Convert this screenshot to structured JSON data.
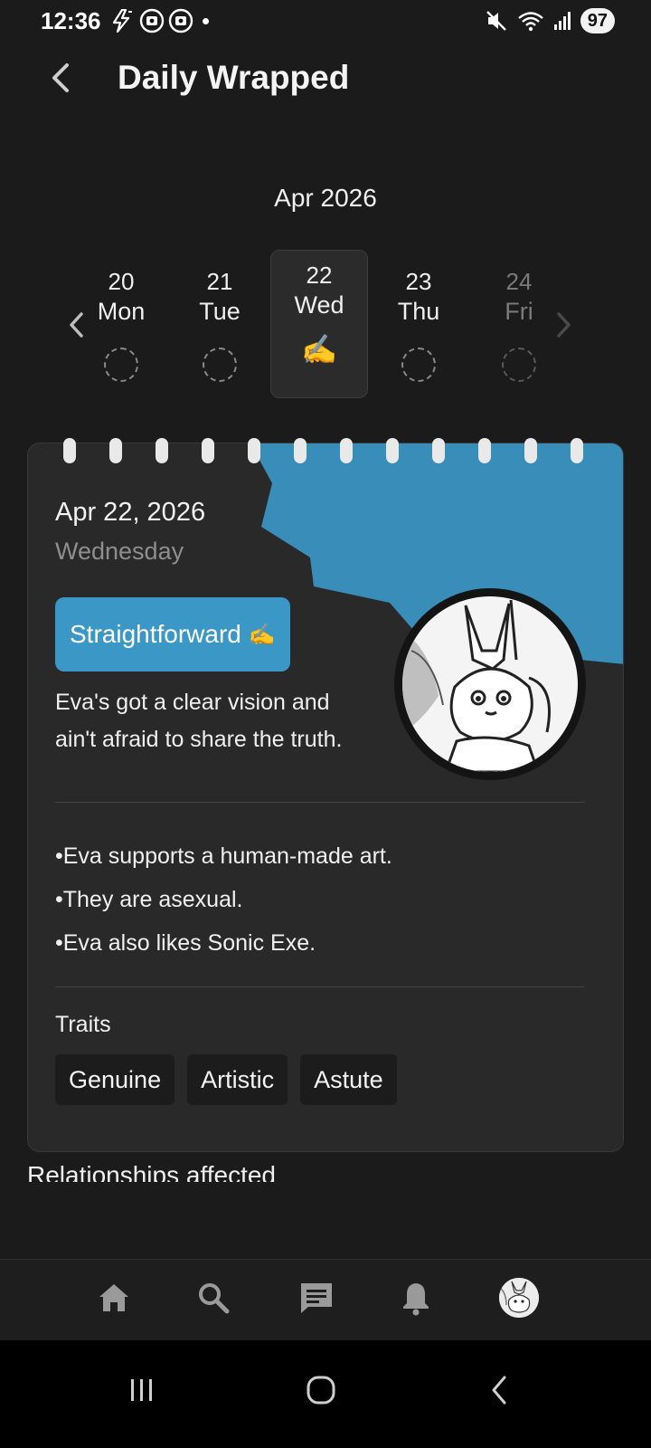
{
  "status_bar": {
    "time": "12:36",
    "battery": "97",
    "icons": [
      "flash-notification-icon",
      "app-notification-icon",
      "app-notification-icon",
      "dot-icon",
      "mute-icon",
      "wifi-icon",
      "signal-icon"
    ]
  },
  "header": {
    "title": "Daily Wrapped",
    "back_icon": "chevron-left-icon"
  },
  "date_picker": {
    "month": "Apr 2026",
    "days": [
      {
        "num": "20",
        "weekday": "Mon"
      },
      {
        "num": "21",
        "weekday": "Tue"
      },
      {
        "num": "22",
        "weekday": "Wed",
        "selected": true,
        "emoji": "✍️"
      },
      {
        "num": "23",
        "weekday": "Thu"
      },
      {
        "num": "24",
        "weekday": "Fri"
      }
    ]
  },
  "card": {
    "date": "Apr 22, 2026",
    "weekday": "Wednesday",
    "tag": "Straightforward",
    "tag_emoji": "✍️",
    "description": "Eva's got a clear vision and ain't afraid to share the truth.",
    "facts": [
      "•Eva supports a human-made art.",
      "•They are asexual.",
      "•Eva also likes Sonic Exe."
    ],
    "traits_label": "Traits",
    "traits": [
      "Genuine",
      "Artistic",
      "Astute"
    ],
    "accent_color": "#3a97c6"
  },
  "section": {
    "heading": "Relationships affected"
  },
  "bottom_nav": [
    "home-icon",
    "search-icon",
    "chat-icon",
    "bell-icon",
    "profile-avatar"
  ],
  "system_nav": [
    "recents-icon",
    "home-circle-icon",
    "back-icon"
  ]
}
